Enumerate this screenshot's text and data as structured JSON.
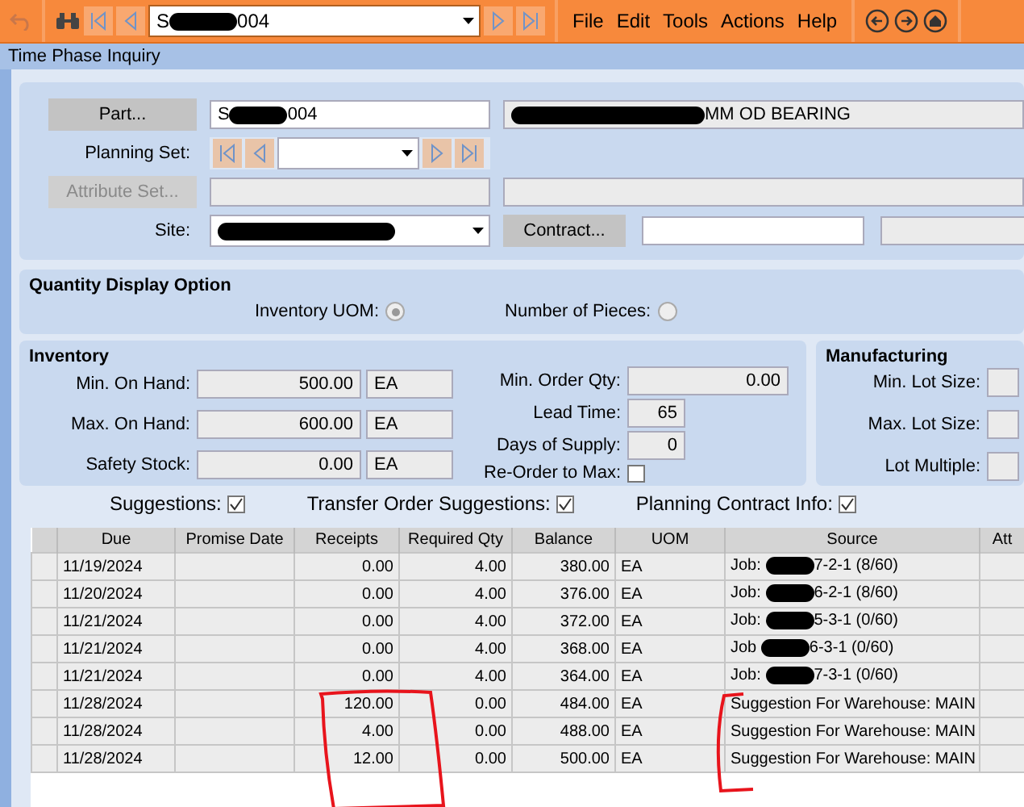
{
  "toolbar": {
    "record": {
      "before": "S",
      "after": "004"
    },
    "menus": [
      "File",
      "Edit",
      "Tools",
      "Actions",
      "Help"
    ]
  },
  "window": {
    "title": "Time Phase Inquiry"
  },
  "part": {
    "button": "Part...",
    "value": {
      "before": "S",
      "after": "004"
    },
    "description": "MM OD BEARING"
  },
  "planning_set": {
    "label": "Planning Set:"
  },
  "attribute_set": {
    "button": "Attribute Set...",
    "disabled": true
  },
  "site": {
    "label": "Site:"
  },
  "contract": {
    "button": "Contract..."
  },
  "quantity_display": {
    "title": "Quantity Display Option",
    "options": [
      {
        "label": "Inventory UOM:",
        "selected": true
      },
      {
        "label": "Number of Pieces:",
        "selected": false
      }
    ]
  },
  "inventory": {
    "title": "Inventory",
    "fields": [
      {
        "label": "Min. On Hand:",
        "value": "500.00",
        "uom": "EA"
      },
      {
        "label": "Max. On Hand:",
        "value": "600.00",
        "uom": "EA"
      },
      {
        "label": "Safety Stock:",
        "value": "0.00",
        "uom": "EA"
      }
    ],
    "order_fields": [
      {
        "kind": "field",
        "label": "Min. Order Qty:",
        "value": "0.00"
      },
      {
        "kind": "field",
        "label": "Lead Time:",
        "value": "65"
      },
      {
        "kind": "field",
        "label": "Days of Supply:",
        "value": "0"
      },
      {
        "kind": "checkbox",
        "label": "Re-Order to Max:",
        "checked": false
      }
    ]
  },
  "manufacturing": {
    "title": "Manufacturing",
    "fields": [
      "Min. Lot Size:",
      "Max. Lot Size:",
      "Lot Multiple:"
    ]
  },
  "flags": [
    {
      "label": "Suggestions:",
      "checked": true
    },
    {
      "label": "Transfer Order Suggestions:",
      "checked": true
    },
    {
      "label": "Planning Contract Info:",
      "checked": true
    }
  ],
  "table": {
    "columns": [
      "Due",
      "Promise Date",
      "Receipts",
      "Required Qty",
      "Balance",
      "UOM",
      "Source",
      "Att"
    ],
    "rows": [
      {
        "due": "11/19/2024",
        "receipts": "0.00",
        "required": "4.00",
        "balance": "380.00",
        "uom": "EA",
        "source": {
          "kind": "redacted",
          "before": "Job:",
          "after": "7-2-1 (8/60)"
        }
      },
      {
        "due": "11/20/2024",
        "receipts": "0.00",
        "required": "4.00",
        "balance": "376.00",
        "uom": "EA",
        "source": {
          "kind": "redacted",
          "before": "Job:",
          "after": "6-2-1 (8/60)"
        }
      },
      {
        "due": "11/21/2024",
        "receipts": "0.00",
        "required": "4.00",
        "balance": "372.00",
        "uom": "EA",
        "source": {
          "kind": "redacted",
          "before": "Job:",
          "after": "5-3-1 (0/60)"
        }
      },
      {
        "due": "11/21/2024",
        "receipts": "0.00",
        "required": "4.00",
        "balance": "368.00",
        "uom": "EA",
        "source": {
          "kind": "redacted",
          "before": "Job",
          "after": "6-3-1 (0/60)"
        }
      },
      {
        "due": "11/21/2024",
        "receipts": "0.00",
        "required": "4.00",
        "balance": "364.00",
        "uom": "EA",
        "source": {
          "kind": "redacted",
          "before": "Job:",
          "after": "7-3-1 (0/60)"
        }
      },
      {
        "due": "11/28/2024",
        "receipts": "120.00",
        "required": "0.00",
        "balance": "484.00",
        "uom": "EA",
        "source": {
          "kind": "plain",
          "text": "Suggestion For Warehouse: MAIN"
        }
      },
      {
        "due": "11/28/2024",
        "receipts": "4.00",
        "required": "0.00",
        "balance": "488.00",
        "uom": "EA",
        "source": {
          "kind": "plain",
          "text": "Suggestion For Warehouse: MAIN"
        }
      },
      {
        "due": "11/28/2024",
        "receipts": "12.00",
        "required": "0.00",
        "balance": "500.00",
        "uom": "EA",
        "source": {
          "kind": "plain",
          "text": "Suggestion For Warehouse: MAIN"
        }
      }
    ]
  }
}
